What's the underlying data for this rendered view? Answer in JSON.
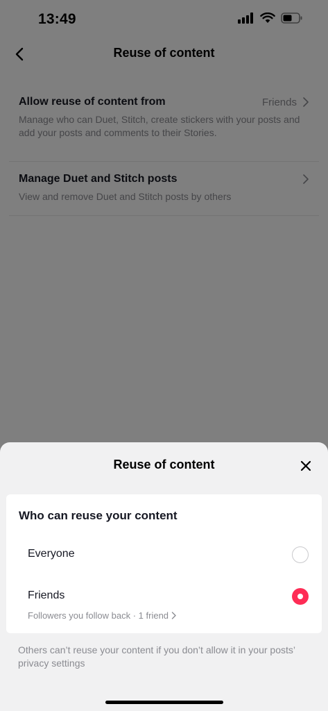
{
  "status_bar": {
    "time": "13:49"
  },
  "nav": {
    "title": "Reuse of content"
  },
  "settings": [
    {
      "title": "Allow reuse of content from",
      "value": "Friends",
      "description": "Manage who can Duet, Stitch, create stickers with your posts and add your posts and comments to their Stories."
    },
    {
      "title": "Manage Duet and Stitch posts",
      "value": "",
      "description": "View and remove Duet and Stitch posts by others"
    }
  ],
  "sheet": {
    "title": "Reuse of content",
    "heading": "Who can reuse your content",
    "options": [
      {
        "label": "Everyone",
        "selected": false,
        "sublabel": ""
      },
      {
        "label": "Friends",
        "selected": true,
        "sublabel": "Followers you follow back · 1 friend"
      }
    ],
    "footer": "Others can’t reuse your content if you don’t allow it in your posts’ privacy settings"
  },
  "colors": {
    "accent": "#fe2c55",
    "secondary_text": "#8a8b91"
  }
}
